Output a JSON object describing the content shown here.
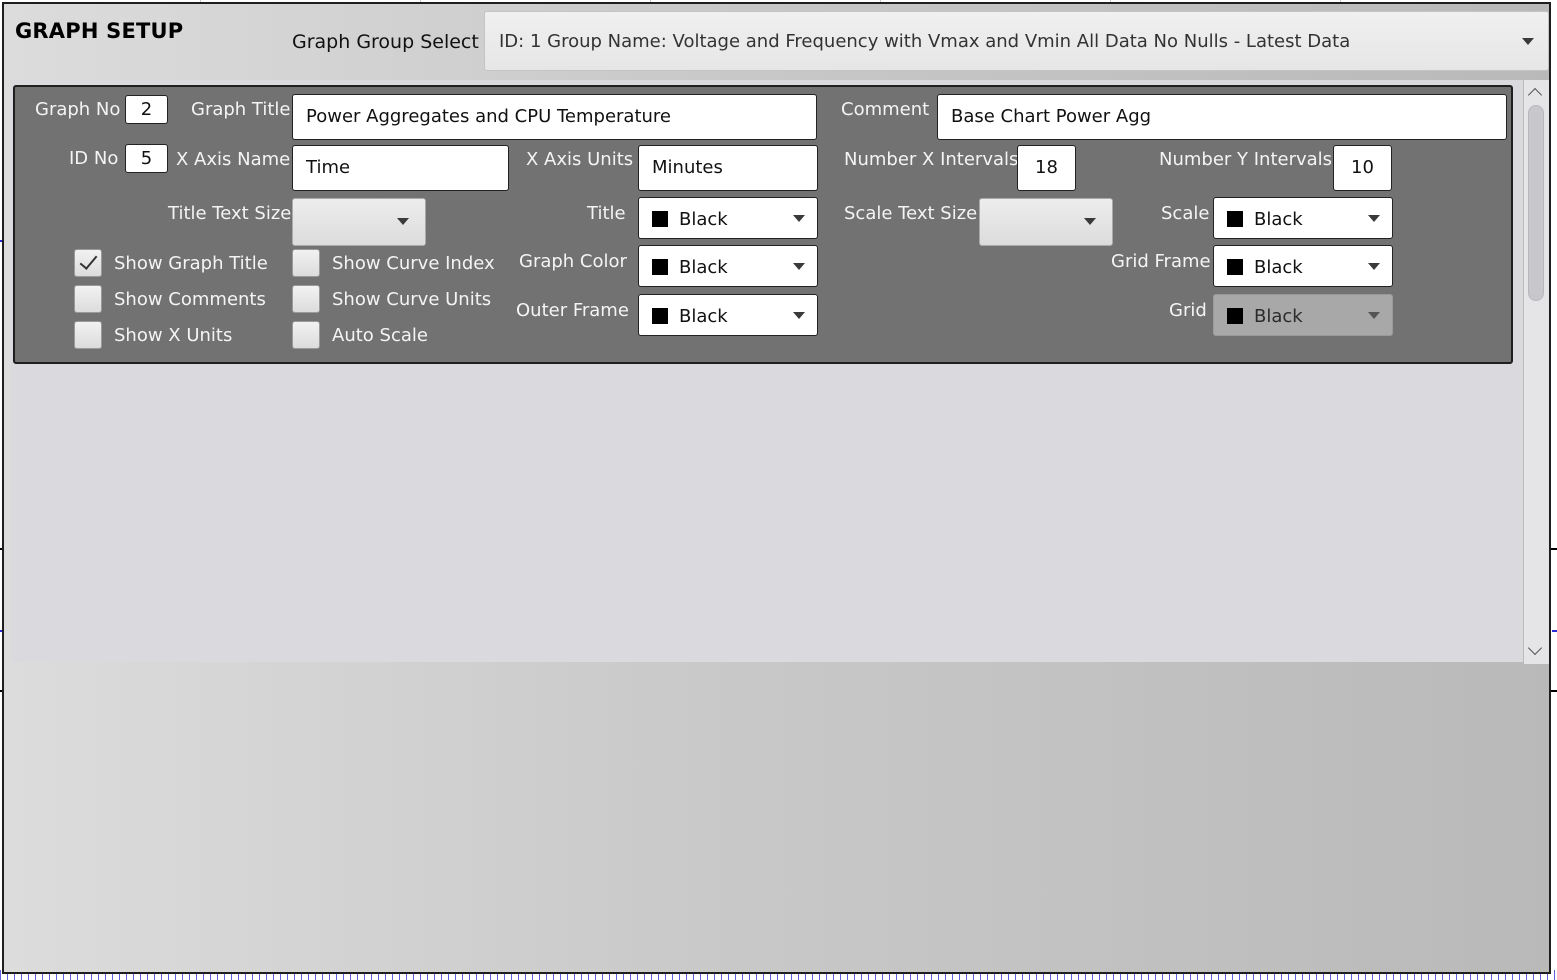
{
  "window": {
    "title": "GRAPH SETUP",
    "group_select_label": "Graph Group Select",
    "group_select_value": "ID: 1  Group Name: Voltage and Frequency with Vmax and Vmin All Data No Nulls - Latest Data"
  },
  "panel": {
    "graph_no_label": "Graph No",
    "graph_no": "2",
    "graph_title_label": "Graph Title",
    "graph_title": "Power Aggregates and CPU Temperature",
    "comment_label": "Comment",
    "comment": "Base Chart Power Agg",
    "id_no_label": "ID No",
    "id_no": "5",
    "x_axis_name_label": "X Axis Name",
    "x_axis_name": "Time",
    "x_axis_units_label": "X Axis Units",
    "x_axis_units": "Minutes",
    "num_x_intervals_label": "Number X Intervals",
    "num_x_intervals": "18",
    "num_y_intervals_label": "Number Y Intervals",
    "num_y_intervals": "10",
    "title_text_size_label": "Title Text Size",
    "title_text_size_value": "",
    "scale_text_size_label": "Scale Text Size",
    "scale_text_size_value": "",
    "colors": {
      "title_label": "Title",
      "title": "Black",
      "graph_color_label": "Graph Color",
      "graph_color": "Black",
      "outer_frame_label": "Outer Frame",
      "outer_frame": "Black",
      "scale_label": "Scale",
      "scale": "Black",
      "grid_frame_label": "Grid Frame",
      "grid_frame": "Black",
      "grid_label": "Grid",
      "grid": "Black"
    },
    "checkboxes": {
      "show_graph_title": {
        "label": "Show Graph Title",
        "checked": true
      },
      "show_comments": {
        "label": "Show Comments",
        "checked": false
      },
      "show_x_units": {
        "label": "Show X Units",
        "checked": false
      },
      "show_curve_index": {
        "label": "Show Curve Index",
        "checked": false
      },
      "show_curve_units": {
        "label": "Show Curve Units",
        "checked": false
      },
      "auto_scale": {
        "label": "Auto Scale",
        "checked": false
      }
    }
  },
  "theme": {
    "panel_bg": "#727272",
    "content_bg": "#dad9dd",
    "swatch": "#000000"
  }
}
